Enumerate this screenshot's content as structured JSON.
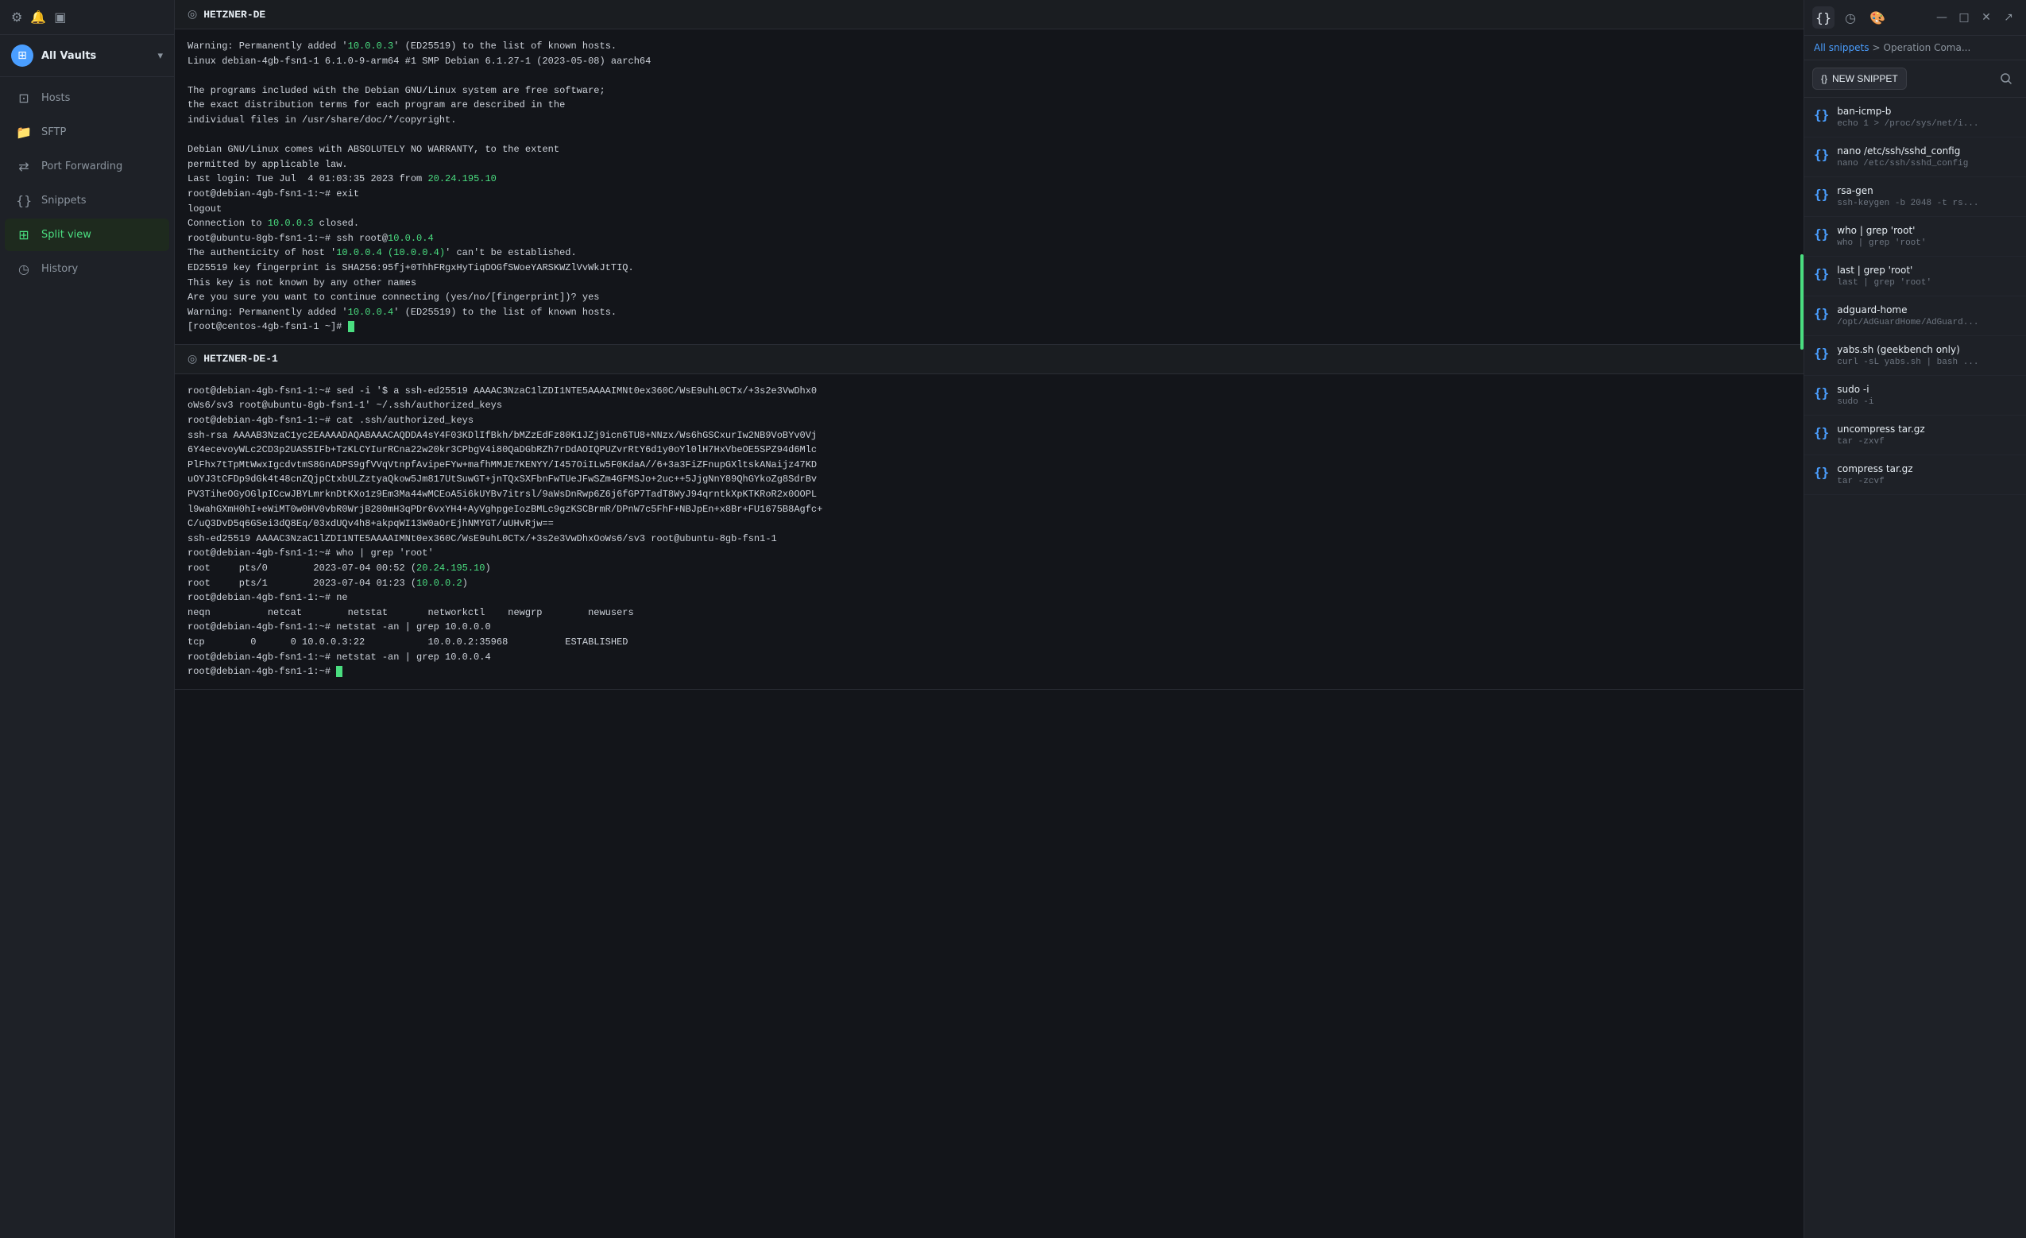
{
  "sidebar": {
    "header_icons": [
      "gear",
      "bell",
      "terminal"
    ],
    "vault": {
      "label": "All Vaults",
      "chevron": "▾"
    },
    "nav_items": [
      {
        "id": "hosts",
        "icon": "⊡",
        "label": "Hosts",
        "active": false
      },
      {
        "id": "sftp",
        "icon": "📁",
        "label": "SFTP",
        "active": false
      },
      {
        "id": "port-forwarding",
        "icon": "⇄",
        "label": "Port Forwarding",
        "active": false
      },
      {
        "id": "snippets",
        "icon": "{}",
        "label": "Snippets",
        "active": false
      },
      {
        "id": "split-view",
        "icon": "⊞",
        "label": "Split view",
        "active": true
      },
      {
        "id": "history",
        "icon": "◷",
        "label": "History",
        "active": false
      }
    ]
  },
  "terminals": [
    {
      "id": "hetzner-de",
      "title": "HETZNER-DE",
      "output": "Warning: Permanently added '10.0.0.3' (ED25519) to the list of known hosts.\nLinux debian-4gb-fsn1-1 6.1.0-9-arm64 #1 SMP Debian 6.1.27-1 (2023-05-08) aarch64\n\nThe programs included with the Debian GNU/Linux system are free software;\nthe exact distribution terms for each program are described in the\nindividual files in /usr/share/doc/*/copyright.\n\nDebian GNU/Linux comes with ABSOLUTELY NO WARRANTY, to the extent\npermitted by applicable law.\nLast login: Tue Jul  4 01:03:35 2023 from 20.24.195.10\nroot@debian-4gb-fsn1-1:~# exit\nlogout\nConnection to 10.0.0.3 closed.\nroot@ubuntu-8gb-fsn1-1:~# ssh root@10.0.0.4\nThe authenticity of host '10.0.0.4 (10.0.0.4)' can't be established.\nED25519 key fingerprint is SHA256:95fj+0ThhFRgxHyTiqDOGfSWoeYARSKWZlVvWkJtTIQ.\nThis key is not known by any other names\nAre you sure you want to continue connecting (yes/no/[fingerprint])? yes\nWarning: Permanently added '10.0.0.4' (ED25519) to the list of known hosts.\n[root@centos-4gb-fsn1-1 ~]#"
    },
    {
      "id": "hetzner-de-1",
      "title": "HETZNER-DE-1",
      "output": "root@debian-4gb-fsn1-1:~# sed -i '$ a ssh-ed25519 AAAAC3NzaC1lZDI1NTE5AAAAIMNt0ex360C/WsE9uhL0CTx/+3s2e3VwDhx0oWs6/sv3 root@ubuntu-8gb-fsn1-1' ~/.ssh/authorized_keys\nroot@debian-4gb-fsn1-1:~# cat .ssh/authorized_keys\nssh-rsa AAAAB3NzaC1yc2EAAAADAQABAAACAQDDA4sY4F03KDlIfBkh/bMZzEdFz80K1JZj9icn6TU8+NNzx/Ws6hGSCxurIw2NB9VoBYv0Vj6Y4ecevoyWLc2CD3p2UAS5IFb+TzKLCYIurRCna22w20kr3CPbgV4i80QaDGbRZh7rDdAOIQPUZvrRtY6d1y0oYl0lH7HxVbeOE5SPZ94d6Mlc PlFhx7tTpMtWwxIgcdvtmS8GnADPS9gfVVqVtnpfAvipeFYw+mafhMMJE7KENYY/I457OiILw5F0KdaA//6+3a3FiZFnupGXltskANaijz47KDuOYJ3tCFDp9dGk4t48cnZQjpCtxbULZztyaQkow5Jm817UtSuwGT+jnTQxSXFbnFwTUeJFwSZm4GFMSJo+2uc++5JjgNnY89QhGYkoZg8SdrBvPV3TiheOGyOGlpICcwJBYLmrknDtKXo1z9Em3Ma44wMCEoA5i6kUYBv7itrsl/9aWsDnRwp6Z6j6fGP7TadT8WyJ94qrntkXpKTKRoR2x0OOPLl9wahGXmH0hI+eWiMT0w0HV0vbR0WrjB280mH3qPDr6vxYH4+AyVghpgeIozBMLc9gzKSCBrmR/DPnW7c5FhF+NBJpEn+x8Br+FU1675B8Agfc+C/uQ3DvD5q6GSei3dQ8Eq/03xdUQv4h8+akpqWI13W0aOrEjhNMYGT/uUHvRjw==\nssh-ed25519 AAAAC3NzaC1lZDI1NTE5AAAAIMNt0ex360C/WsE9uhL0CTx/+3s2e3VwDhxOoWs6/sv3 root@ubuntu-8gb-fsn1-1\nroot@debian-4gb-fsn1-1:~# who | grep 'root'\nroot     pts/0        2023-07-04 00:52 (20.24.195.10)\nroot     pts/1        2023-07-04 01:23 (10.0.0.2)\nroot@debian-4gb-fsn1-1:~# ne\nneqn          netcat        netstat       networkctl    newgrp        newusers\nroot@debian-4gb-fsn1-1:~# netstat -an | grep 10.0.0.0\ntcp        0      0 10.0.0.3:22           10.0.0.2:35968          ESTABLISHED\nroot@debian-4gb-fsn1-1:~# netstat -an | grep 10.0.0.4\nroot@debian-4gb-fsn1-1:~#"
    }
  ],
  "snippets_panel": {
    "breadcrumb_link": "All snippets",
    "breadcrumb_sep": ">",
    "breadcrumb_current": "Operation Coma...",
    "new_snippet_label": "NEW SNIPPET",
    "snippets": [
      {
        "id": "ban-icmp-b",
        "name": "ban-icmp-b",
        "preview": "echo 1 > /proc/sys/net/i..."
      },
      {
        "id": "nano-sshd",
        "name": "nano /etc/ssh/sshd_config",
        "preview": "nano /etc/ssh/sshd_config"
      },
      {
        "id": "rsa-gen",
        "name": "rsa-gen",
        "preview": "ssh-keygen -b 2048 -t rs..."
      },
      {
        "id": "who-grep-root",
        "name": "who | grep 'root'",
        "preview": "who  |  grep 'root'"
      },
      {
        "id": "last-grep-root",
        "name": "last | grep 'root'",
        "preview": "last  |  grep 'root'"
      },
      {
        "id": "adguard-home",
        "name": "adguard-home",
        "preview": "/opt/AdGuardHome/AdGuard..."
      },
      {
        "id": "yabs-geekbench",
        "name": "yabs.sh (geekbench only)",
        "preview": "curl -sL yabs.sh | bash ..."
      },
      {
        "id": "sudo-i",
        "name": "sudo -i",
        "preview": "sudo -i"
      },
      {
        "id": "uncompress-tar",
        "name": "uncompress tar.gz",
        "preview": "tar -zxvf"
      },
      {
        "id": "compress-tar",
        "name": "compress tar.gz",
        "preview": "tar -zcvf"
      }
    ]
  }
}
